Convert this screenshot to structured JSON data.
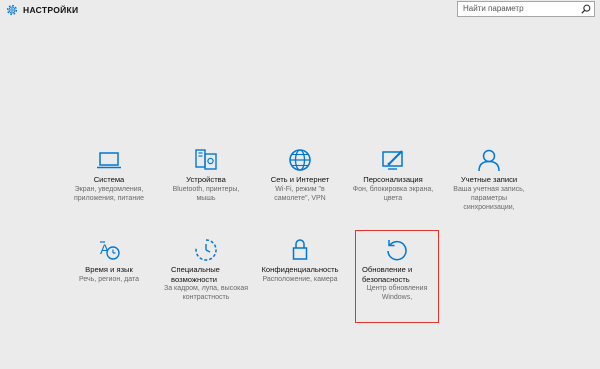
{
  "header": {
    "title": "НАСТРОЙКИ",
    "search_placeholder": "Найти параметр"
  },
  "tiles": [
    {
      "name": "Система",
      "desc": "Экран, уведомления, приложения, питание",
      "icon": "laptop-icon"
    },
    {
      "name": "Устройства",
      "desc": "Bluetooth, принтеры, мышь",
      "icon": "devices-icon"
    },
    {
      "name": "Сеть и Интернет",
      "desc": "Wi-Fi, режим \"в самолете\", VPN",
      "icon": "globe-icon"
    },
    {
      "name": "Персонализация",
      "desc": "Фон, блокировка экрана, цвета",
      "icon": "personalization-icon"
    },
    {
      "name": "Учетные записи",
      "desc": "Ваша учетная запись, параметры синхронизации,",
      "icon": "person-icon"
    },
    {
      "name": "Время и язык",
      "desc": "Речь, регион, дата",
      "icon": "time-language-icon"
    },
    {
      "name": "Специальные возможности",
      "desc": "За кадром, лупа, высокая контрастность",
      "icon": "accessibility-icon"
    },
    {
      "name": "Конфиденциальность",
      "desc": "Расположение, камера",
      "icon": "lock-icon"
    },
    {
      "name": "Обновление и безопасность",
      "desc": "Центр обновления Windows,",
      "icon": "update-icon"
    }
  ],
  "colors": {
    "accent": "#0078d7",
    "highlight": "#e0362e",
    "background": "#ebebeb"
  }
}
